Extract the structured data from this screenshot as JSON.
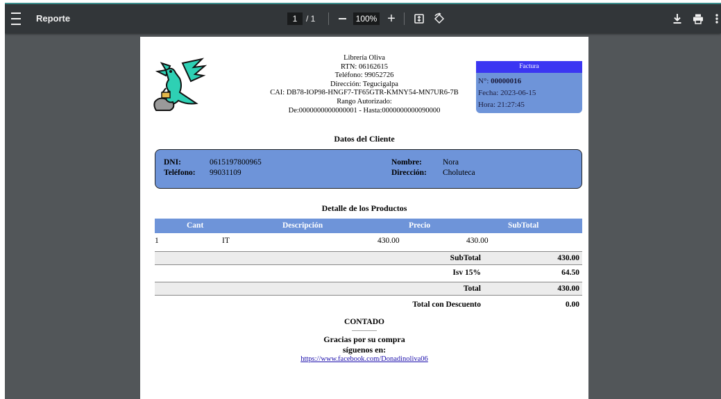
{
  "toolbar": {
    "title": "Reporte",
    "page_current": "1",
    "page_total": "/ 1",
    "zoom": "100%"
  },
  "company": {
    "name": "Librería Oliva",
    "rtn": "RTN: 06162615",
    "phone": "Teléfono: 99052726",
    "address": "Dirección: Tegucigalpa",
    "cai": "CAI: DB78-IOP98-HNGF7-TF65GTR-KMNY54-MN7UR6-7B",
    "range_label": "Rango Autorizado:",
    "range_value": "De:0000000000000001 - Hasta:0000000000090000"
  },
  "invoice": {
    "header": "Factura",
    "number_label": "N°:",
    "number": "00000016",
    "date": "Fecha: 2023-06-15",
    "time": "Hora: 21:27:45"
  },
  "client": {
    "section_title": "Datos del Cliente",
    "dni_label": "DNI:",
    "dni": "0615197800965",
    "phone_label": "Teléfono:",
    "phone": "99031109",
    "name_label": "Nombre:",
    "name": "Nora",
    "address_label": "Dirección:",
    "address": "Choluteca"
  },
  "products": {
    "section_title": "Detalle de los Productos",
    "columns": [
      "Cant",
      "Descripción",
      "Precio",
      "SubTotal"
    ],
    "rows": [
      {
        "cant": "1",
        "desc": "IT",
        "precio": "430.00",
        "subtotal": "430.00"
      }
    ]
  },
  "totals": [
    {
      "label": "SubTotal",
      "value": "430.00"
    },
    {
      "label": "Isv 15%",
      "value": "64.50"
    },
    {
      "label": "Total",
      "value": "430.00"
    },
    {
      "label": "Total con Descuento",
      "value": "0.00"
    }
  ],
  "footer": {
    "payment": "CONTADO",
    "dots": "..................",
    "thanks": "Gracias por su compra",
    "follow": "síguenos en:",
    "link": "https://www.facebook.com/Donadinoliva06"
  },
  "colors": {
    "toolbar": "#323639",
    "viewer_bg": "#525659",
    "accent_blue": "#6e94d9",
    "factura_header": "#3b36f2"
  }
}
